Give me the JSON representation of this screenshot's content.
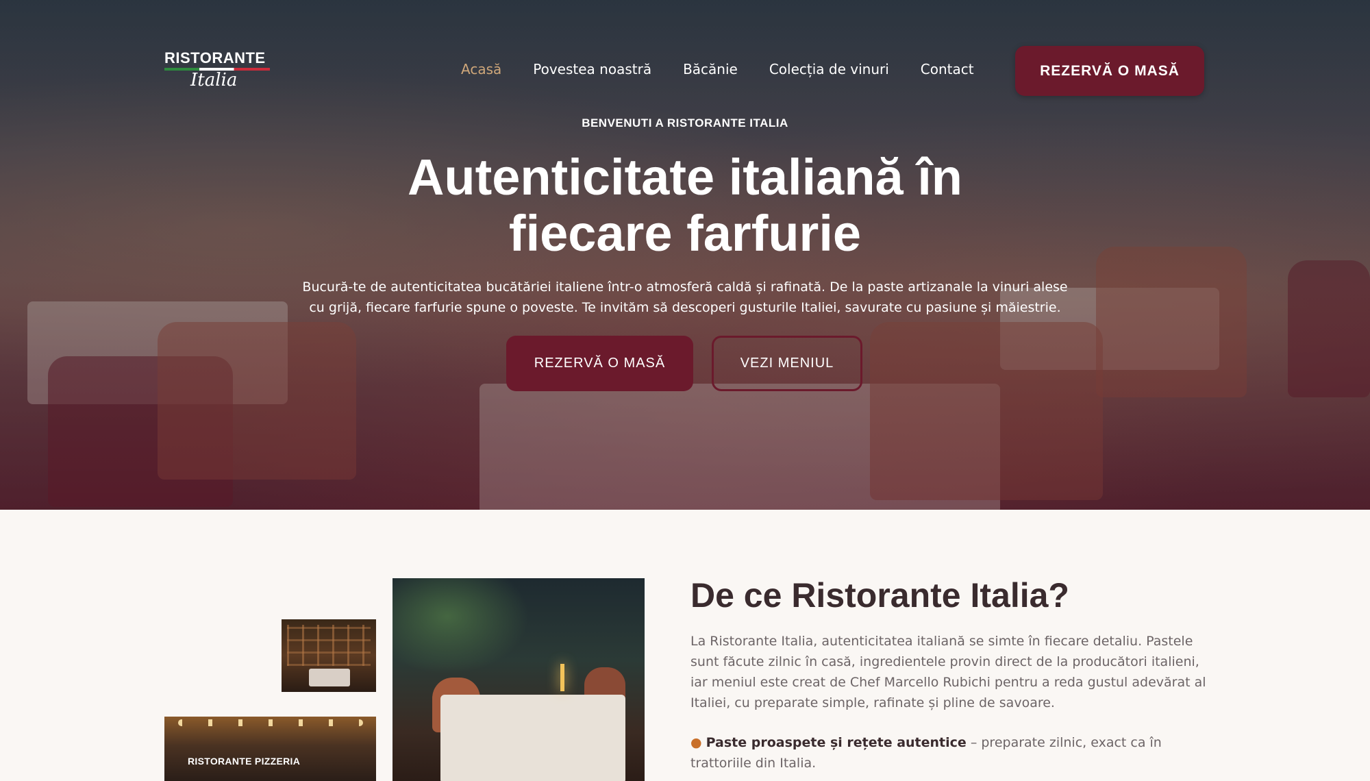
{
  "brand": {
    "name_line1": "RISTORANTE",
    "name_line2": "Italia"
  },
  "nav": {
    "items": [
      {
        "label": "Acasă",
        "active": true
      },
      {
        "label": "Povestea noastră",
        "active": false
      },
      {
        "label": "Băcănie",
        "active": false
      },
      {
        "label": "Colecția de vinuri",
        "active": false
      },
      {
        "label": "Contact",
        "active": false
      }
    ],
    "cta_label": "REZERVĂ O MASĂ"
  },
  "hero": {
    "kicker": "BENVENUTI A RISTORANTE ITALIA",
    "title": "Autenticitate italiană în fiecare farfurie",
    "lead": "Bucură-te de autenticitatea bucătăriei italiene într-o atmosferă caldă și rafinată. De la paste artizanale la vinuri alese cu grijă, fiecare farfurie spune o poveste. Te invităm să descoperi gusturile Italiei, savurate cu pasiune și măiestrie.",
    "primary_button": "REZERVĂ O MASĂ",
    "secondary_button": "VEZI MENIUL"
  },
  "why": {
    "title": "De ce Ristorante Italia?",
    "body": "La Ristorante Italia, autenticitatea italiană se simte în fiecare detaliu. Pastele sunt făcute zilnic în casă, ingredientele provin direct de la producători italieni, iar meniul este creat de Chef Marcello Rubichi pentru a reda gustul adevărat al Italiei, cu preparate simple, rafinate și pline de savoare.",
    "point_icon": "pasta-bowl-icon",
    "point_title": "Paste proaspete și rețete autentice",
    "point_text": " – preparate zilnic, exact ca în trattoriile din Italia.",
    "photo_sign": "RISTORANTE PIZZERIA"
  },
  "colors": {
    "accent": "#6b1a2c",
    "nav_active": "#cfa77a",
    "page_bg": "#faf7f4",
    "heading": "#3a2b2e",
    "body_text": "#6c6466"
  }
}
